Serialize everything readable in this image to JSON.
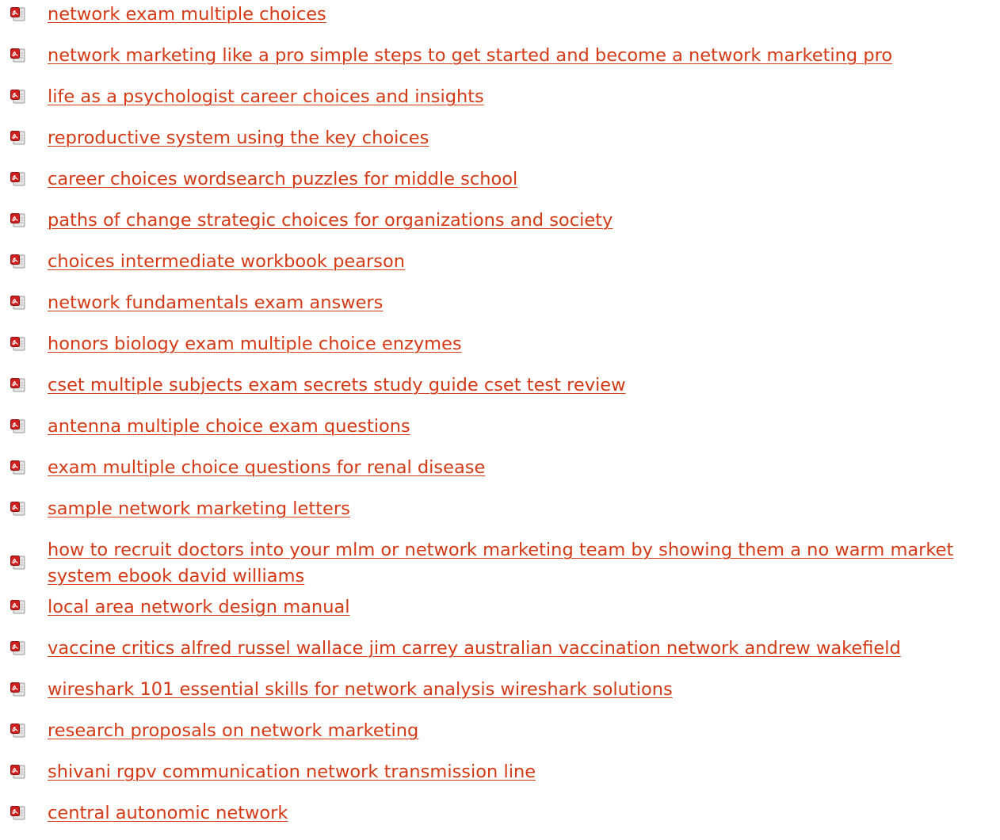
{
  "documents": [
    {
      "title": "network exam multiple choices",
      "icon": "pdf-file-icon"
    },
    {
      "title": "network marketing like a pro simple steps to get started and become a network marketing pro",
      "icon": "pdf-file-icon"
    },
    {
      "title": "life as a psychologist career choices and insights",
      "icon": "pdf-file-icon"
    },
    {
      "title": "reproductive system using the key choices",
      "icon": "pdf-file-icon"
    },
    {
      "title": "career choices wordsearch puzzles for middle school",
      "icon": "pdf-file-icon"
    },
    {
      "title": "paths of change strategic choices for organizations and society",
      "icon": "pdf-file-icon"
    },
    {
      "title": "choices intermediate workbook pearson",
      "icon": "pdf-file-icon"
    },
    {
      "title": "network fundamentals exam answers",
      "icon": "pdf-file-icon"
    },
    {
      "title": "honors biology exam multiple choice enzymes",
      "icon": "pdf-file-icon"
    },
    {
      "title": "cset multiple subjects exam secrets study guide cset test review",
      "icon": "pdf-file-icon"
    },
    {
      "title": "antenna multiple choice exam questions",
      "icon": "pdf-file-icon"
    },
    {
      "title": "exam multiple choice questions for renal disease",
      "icon": "pdf-file-icon"
    },
    {
      "title": "sample network marketing letters",
      "icon": "pdf-file-icon"
    },
    {
      "title": "how to recruit doctors into your mlm or network marketing team by showing them a no warm market system ebook david williams",
      "icon": "pdf-file-icon"
    },
    {
      "title": "local area network design manual",
      "icon": "pdf-file-icon"
    },
    {
      "title": "vaccine critics alfred russel wallace jim carrey australian vaccination network andrew wakefield",
      "icon": "pdf-file-icon"
    },
    {
      "title": "wireshark 101 essential skills for network analysis wireshark solutions",
      "icon": "pdf-file-icon"
    },
    {
      "title": "research proposals on network marketing",
      "icon": "pdf-file-icon"
    },
    {
      "title": "shivani rgpv communication network transmission line",
      "icon": "pdf-file-icon"
    },
    {
      "title": "central autonomic network",
      "icon": "pdf-file-icon"
    }
  ],
  "colors": {
    "link": "#d43a16",
    "icon_red": "#cc1f1f",
    "icon_page": "#e6e6e6"
  }
}
